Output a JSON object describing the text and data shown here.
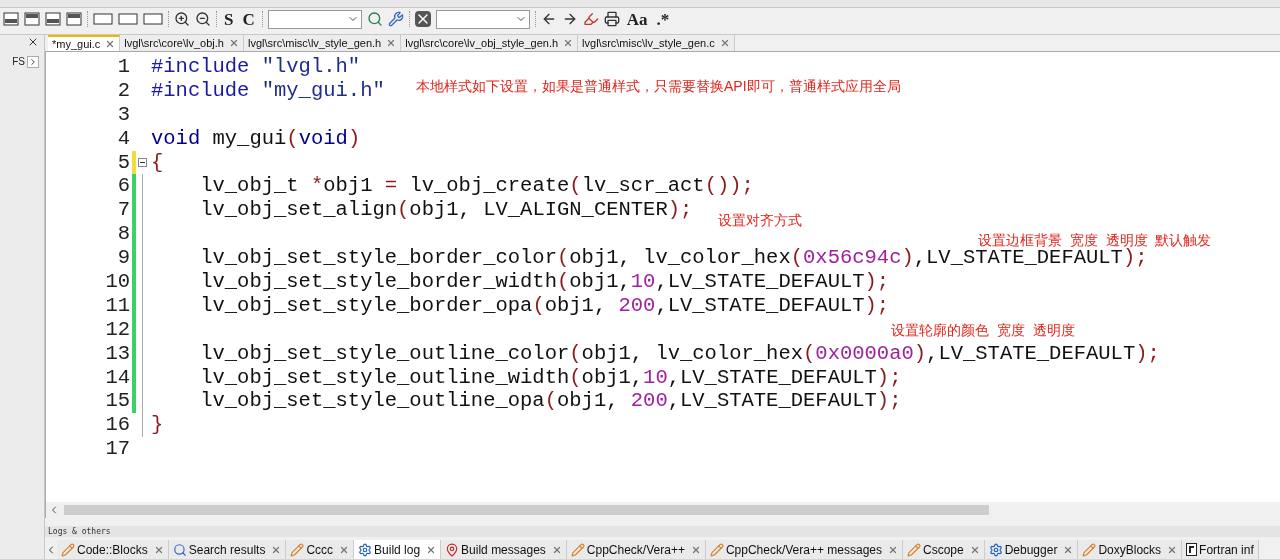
{
  "toolbar": [
    {
      "kind": "icon"
    },
    {
      "kind": "icon"
    },
    {
      "kind": "icon"
    },
    {
      "kind": "icon"
    },
    {
      "kind": "sep"
    },
    {
      "kind": "icon"
    },
    {
      "kind": "icon"
    },
    {
      "kind": "icon"
    },
    {
      "kind": "sep"
    },
    {
      "kind": "icon"
    },
    {
      "kind": "icon"
    },
    {
      "kind": "sep"
    },
    {
      "kind": "text",
      "text": "S"
    },
    {
      "kind": "text",
      "text": "C"
    },
    {
      "kind": "sep"
    },
    {
      "kind": "combo"
    },
    {
      "kind": "icon"
    },
    {
      "kind": "icon"
    },
    {
      "kind": "sep"
    },
    {
      "kind": "icon"
    },
    {
      "kind": "combo"
    },
    {
      "kind": "sep"
    },
    {
      "kind": "icon"
    },
    {
      "kind": "icon"
    },
    {
      "kind": "icon"
    },
    {
      "kind": "icon"
    },
    {
      "kind": "text",
      "text": "Aa"
    },
    {
      "kind": "text",
      "text": ".*"
    }
  ],
  "side_panel": {
    "label": "FS"
  },
  "editor_tabs": [
    {
      "label": "*my_gui.c",
      "selected": true
    },
    {
      "label": "lvgl\\src\\core\\lv_obj.h",
      "selected": false
    },
    {
      "label": "lvgl\\src\\misc\\lv_style_gen.h",
      "selected": false
    },
    {
      "label": "lvgl\\src\\core\\lv_obj_style_gen.h",
      "selected": false
    },
    {
      "label": "lvgl\\src\\misc\\lv_style_gen.c",
      "selected": false
    }
  ],
  "code": [
    {
      "number": "1",
      "tokens": [
        {
          "kind": "pre",
          "text": "#include "
        },
        {
          "kind": "str",
          "text": "\"lvgl.h\""
        }
      ]
    },
    {
      "number": "2",
      "tokens": [
        {
          "kind": "pre",
          "text": "#include "
        },
        {
          "kind": "str",
          "text": "\"my_gui.h\""
        }
      ]
    },
    {
      "number": "3"
    },
    {
      "number": "4",
      "tokens": [
        {
          "kind": "kw",
          "text": "void"
        },
        {
          "kind": "txt",
          "text": " my_gui"
        },
        {
          "kind": "op",
          "text": "("
        },
        {
          "kind": "kw",
          "text": "void"
        },
        {
          "kind": "op",
          "text": ")"
        }
      ]
    },
    {
      "number": "5",
      "fold": true,
      "tokens": [
        {
          "kind": "op",
          "text": "{"
        }
      ]
    },
    {
      "number": "6",
      "tokens": [
        {
          "kind": "txt",
          "text": "    lv_obj_t "
        },
        {
          "kind": "op",
          "text": "*"
        },
        {
          "kind": "txt",
          "text": "obj1 "
        },
        {
          "kind": "op",
          "text": "="
        },
        {
          "kind": "txt",
          "text": " lv_obj_create"
        },
        {
          "kind": "op",
          "text": "("
        },
        {
          "kind": "txt",
          "text": "lv_scr_act"
        },
        {
          "kind": "op",
          "text": "());"
        }
      ]
    },
    {
      "number": "7",
      "tokens": [
        {
          "kind": "txt",
          "text": "    lv_obj_set_align"
        },
        {
          "kind": "op",
          "text": "("
        },
        {
          "kind": "txt",
          "text": "obj1, LV_ALIGN_CENTER"
        },
        {
          "kind": "op",
          "text": ");"
        }
      ]
    },
    {
      "number": "8"
    },
    {
      "number": "9",
      "tokens": [
        {
          "kind": "txt",
          "text": "    lv_obj_set_style_border_color"
        },
        {
          "kind": "op",
          "text": "("
        },
        {
          "kind": "txt",
          "text": "obj1, lv_color_hex"
        },
        {
          "kind": "op",
          "text": "("
        },
        {
          "kind": "num",
          "text": "0x56c94c"
        },
        {
          "kind": "op",
          "text": ")"
        },
        {
          "kind": "txt",
          "text": ",LV_STATE_DEFAULT"
        },
        {
          "kind": "op",
          "text": ");"
        }
      ]
    },
    {
      "number": "10",
      "tokens": [
        {
          "kind": "txt",
          "text": "    lv_obj_set_style_border_width"
        },
        {
          "kind": "op",
          "text": "("
        },
        {
          "kind": "txt",
          "text": "obj1,"
        },
        {
          "kind": "num",
          "text": "10"
        },
        {
          "kind": "txt",
          "text": ",LV_STATE_DEFAULT"
        },
        {
          "kind": "op",
          "text": ");"
        }
      ]
    },
    {
      "number": "11",
      "tokens": [
        {
          "kind": "txt",
          "text": "    lv_obj_set_style_border_opa"
        },
        {
          "kind": "op",
          "text": "("
        },
        {
          "kind": "txt",
          "text": "obj1, "
        },
        {
          "kind": "num",
          "text": "200"
        },
        {
          "kind": "txt",
          "text": ",LV_STATE_DEFAULT"
        },
        {
          "kind": "op",
          "text": ");"
        }
      ]
    },
    {
      "number": "12"
    },
    {
      "number": "13",
      "tokens": [
        {
          "kind": "txt",
          "text": "    lv_obj_set_style_outline_color"
        },
        {
          "kind": "op",
          "text": "("
        },
        {
          "kind": "txt",
          "text": "obj1, lv_color_hex"
        },
        {
          "kind": "op",
          "text": "("
        },
        {
          "kind": "num",
          "text": "0x0000a0"
        },
        {
          "kind": "op",
          "text": ")"
        },
        {
          "kind": "txt",
          "text": ",LV_STATE_DEFAULT"
        },
        {
          "kind": "op",
          "text": ");"
        }
      ]
    },
    {
      "number": "14",
      "tokens": [
        {
          "kind": "txt",
          "text": "    lv_obj_set_style_outline_width"
        },
        {
          "kind": "op",
          "text": "("
        },
        {
          "kind": "txt",
          "text": "obj1,"
        },
        {
          "kind": "num",
          "text": "10"
        },
        {
          "kind": "txt",
          "text": ",LV_STATE_DEFAULT"
        },
        {
          "kind": "op",
          "text": ");"
        }
      ]
    },
    {
      "number": "15",
      "tokens": [
        {
          "kind": "txt",
          "text": "    lv_obj_set_style_outline_opa"
        },
        {
          "kind": "op",
          "text": "("
        },
        {
          "kind": "txt",
          "text": "obj1, "
        },
        {
          "kind": "num",
          "text": "200"
        },
        {
          "kind": "txt",
          "text": ",LV_STATE_DEFAULT"
        },
        {
          "kind": "op",
          "text": ");"
        }
      ]
    },
    {
      "number": "16",
      "tokens": [
        {
          "kind": "op",
          "text": "}"
        }
      ]
    },
    {
      "number": "17"
    }
  ],
  "annotations": [
    {
      "text": "本地样式如下设置，如果是普通样式，只需要替换API即可，普通样式应用全局"
    },
    {
      "text": "设置对齐方式"
    },
    {
      "text": "设置边框背景  宽度  透明度  默认触发"
    },
    {
      "text": "设置轮廓的颜色  宽度  透明度"
    }
  ],
  "logs_panel": {
    "title": "Logs & others",
    "tabs": [
      {
        "label": "Code::Blocks",
        "kind": "pencil",
        "selected": false
      },
      {
        "label": "Search results",
        "kind": "search",
        "selected": false
      },
      {
        "label": "Cccc",
        "kind": "pencil",
        "selected": false
      },
      {
        "label": "Build log",
        "kind": "gear",
        "selected": true
      },
      {
        "label": "Build messages",
        "kind": "pin",
        "selected": false
      },
      {
        "label": "CppCheck/Vera++",
        "kind": "pencil",
        "selected": false
      },
      {
        "label": "CppCheck/Vera++ messages",
        "kind": "pencil",
        "selected": false
      },
      {
        "label": "Cscope",
        "kind": "pencil",
        "selected": false
      },
      {
        "label": "Debugger",
        "kind": "gear",
        "selected": false
      },
      {
        "label": "DoxyBlocks",
        "kind": "pencil",
        "selected": false
      },
      {
        "label": "Fortran inf",
        "kind": "fortran",
        "selected": false
      }
    ]
  }
}
